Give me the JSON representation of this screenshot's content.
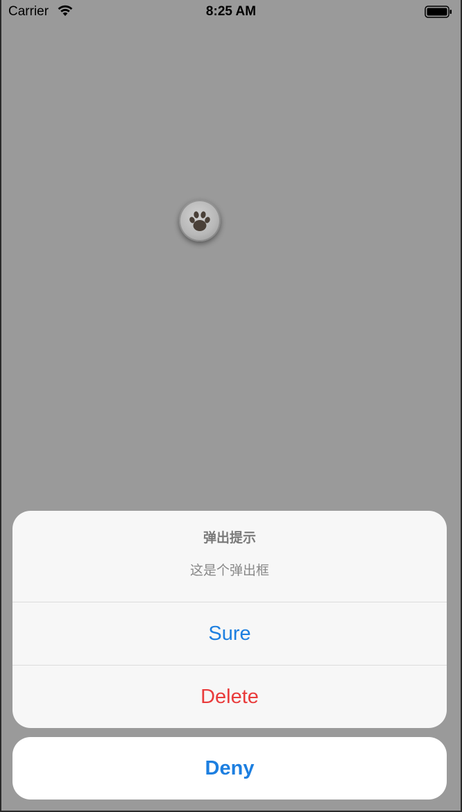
{
  "status_bar": {
    "carrier": "Carrier",
    "time": "8:25 AM",
    "wifi_icon": "wifi-icon",
    "battery_icon": "battery-icon"
  },
  "floating_button": {
    "icon": "paw-icon"
  },
  "action_sheet": {
    "title": "弹出提示",
    "message": "这是个弹出框",
    "actions": [
      {
        "label": "Sure",
        "color": "#1d7fe0"
      },
      {
        "label": "Delete",
        "color": "#e93b3b"
      }
    ],
    "cancel": {
      "label": "Deny",
      "color": "#1d7fe0"
    }
  },
  "colors": {
    "dim_background": "#9a9a9a",
    "sheet_background": "#f7f7f7",
    "cancel_background": "#ffffff"
  }
}
